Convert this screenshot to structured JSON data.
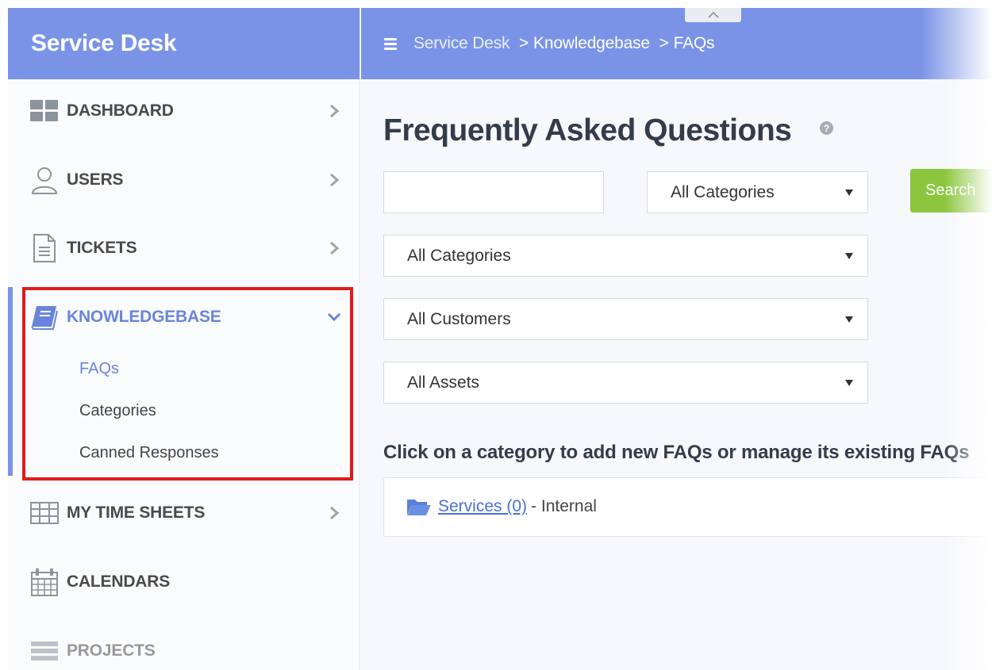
{
  "app": {
    "title": "Service Desk"
  },
  "topbar": {
    "breadcrumb_root": "Service Desk",
    "breadcrumb_section": "Knowledgebase",
    "breadcrumb_page": "FAQs",
    "separator": ">"
  },
  "sidebar": {
    "items": [
      {
        "label": "DASHBOARD",
        "icon": "dashboard-grid-icon"
      },
      {
        "label": "USERS",
        "icon": "user-icon"
      },
      {
        "label": "TICKETS",
        "icon": "document-icon"
      },
      {
        "label": "KNOWLEDGEBASE",
        "icon": "book-icon",
        "expanded": true
      },
      {
        "label": "MY TIME SHEETS",
        "icon": "table-icon"
      },
      {
        "label": "CALENDARS",
        "icon": "calendar-icon"
      },
      {
        "label": "PROJECTS",
        "icon": "projects-icon"
      }
    ],
    "knowledgebase_subitems": [
      {
        "label": "FAQs",
        "current": true
      },
      {
        "label": "Categories"
      },
      {
        "label": "Canned Responses"
      }
    ]
  },
  "main": {
    "title": "Frequently Asked Questions",
    "search": {
      "value": "",
      "category_select": "All Categories",
      "button_label": "Search"
    },
    "filters": {
      "categories": "All Categories",
      "customers": "All Customers",
      "assets": "All Assets"
    },
    "instruction": "Click on a category to add new FAQs or manage its existing FAQs",
    "categories": [
      {
        "name": "Services",
        "count": "(0)",
        "suffix": "- Internal"
      }
    ]
  },
  "colors": {
    "header_bg": "#7a93e6",
    "accent": "#6a84dc",
    "highlight": "#e21b1b",
    "search_button": "#8cc63f"
  }
}
